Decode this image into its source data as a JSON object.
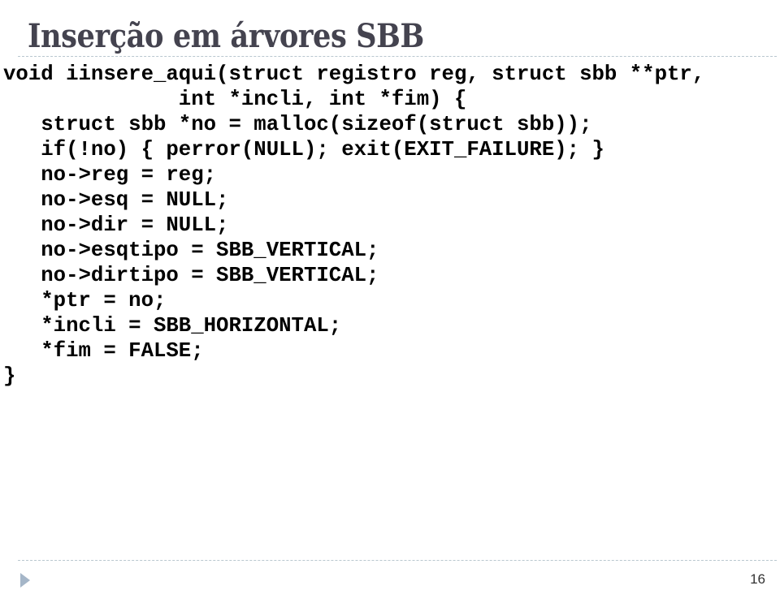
{
  "slide": {
    "title": "Inserção em árvores SBB",
    "code_lines": [
      "void iinsere_aqui(struct registro reg, struct sbb **ptr,",
      "              int *incli, int *fim) {",
      "   struct sbb *no = malloc(sizeof(struct sbb));",
      "   if(!no) { perror(NULL); exit(EXIT_FAILURE); }",
      "   no->reg = reg;",
      "   no->esq = NULL;",
      "   no->dir = NULL;",
      "   no->esqtipo = SBB_VERTICAL;",
      "   no->dirtipo = SBB_VERTICAL;",
      "   *ptr = no;",
      "   *incli = SBB_HORIZONTAL;",
      "   *fim = FALSE;",
      "}"
    ],
    "page_number": "16",
    "icons": {
      "bullet": "triangle-right-icon"
    },
    "colors": {
      "title": "#44434f",
      "rule": "#b9c7cf",
      "bullet": "#a5b6c8"
    }
  }
}
